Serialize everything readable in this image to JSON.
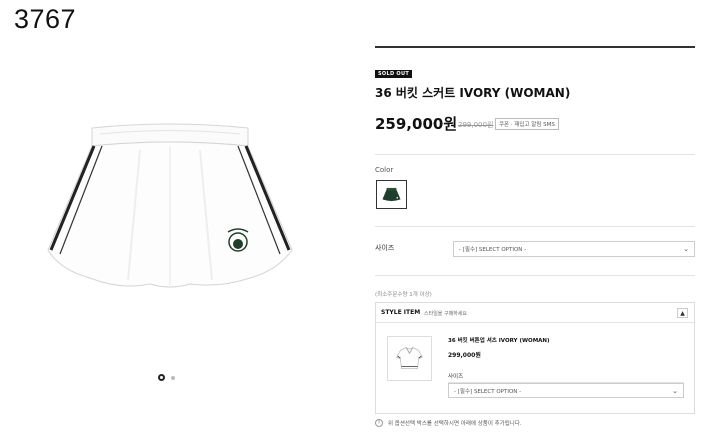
{
  "page_code": "3767",
  "product": {
    "badge": "SOLD OUT",
    "name": "36 버킷 스커트 IVORY (WOMAN)",
    "price": "259,000원",
    "old_price": "299,000원",
    "coupon": "쿠폰 · 재입고 알림 SMS"
  },
  "gallery": {
    "current": 1,
    "total": 2
  },
  "color": {
    "label": "Color",
    "swatch_color": "#1f3f2c"
  },
  "size": {
    "label": "사이즈",
    "placeholder": "- [필수] SELECT OPTION -"
  },
  "min_qty": "(최소주문수량 1개 이상)",
  "style_item": {
    "title": "STYLE ITEM",
    "subtitle": "스타일을 구매하세요",
    "toggle": "▲",
    "related": {
      "name": "36 버킷 버튼업 셔츠 IVORY (WOMAN)",
      "price": "299,000원",
      "size_label": "사이즈",
      "placeholder": "- [필수] SELECT OPTION -"
    }
  },
  "notice": "위 옵션선택 박스를 선택하시면 아래에 상품이 추가됩니다.",
  "icons": {
    "dropdown": "chevron-down-icon",
    "notice": "info-icon"
  }
}
